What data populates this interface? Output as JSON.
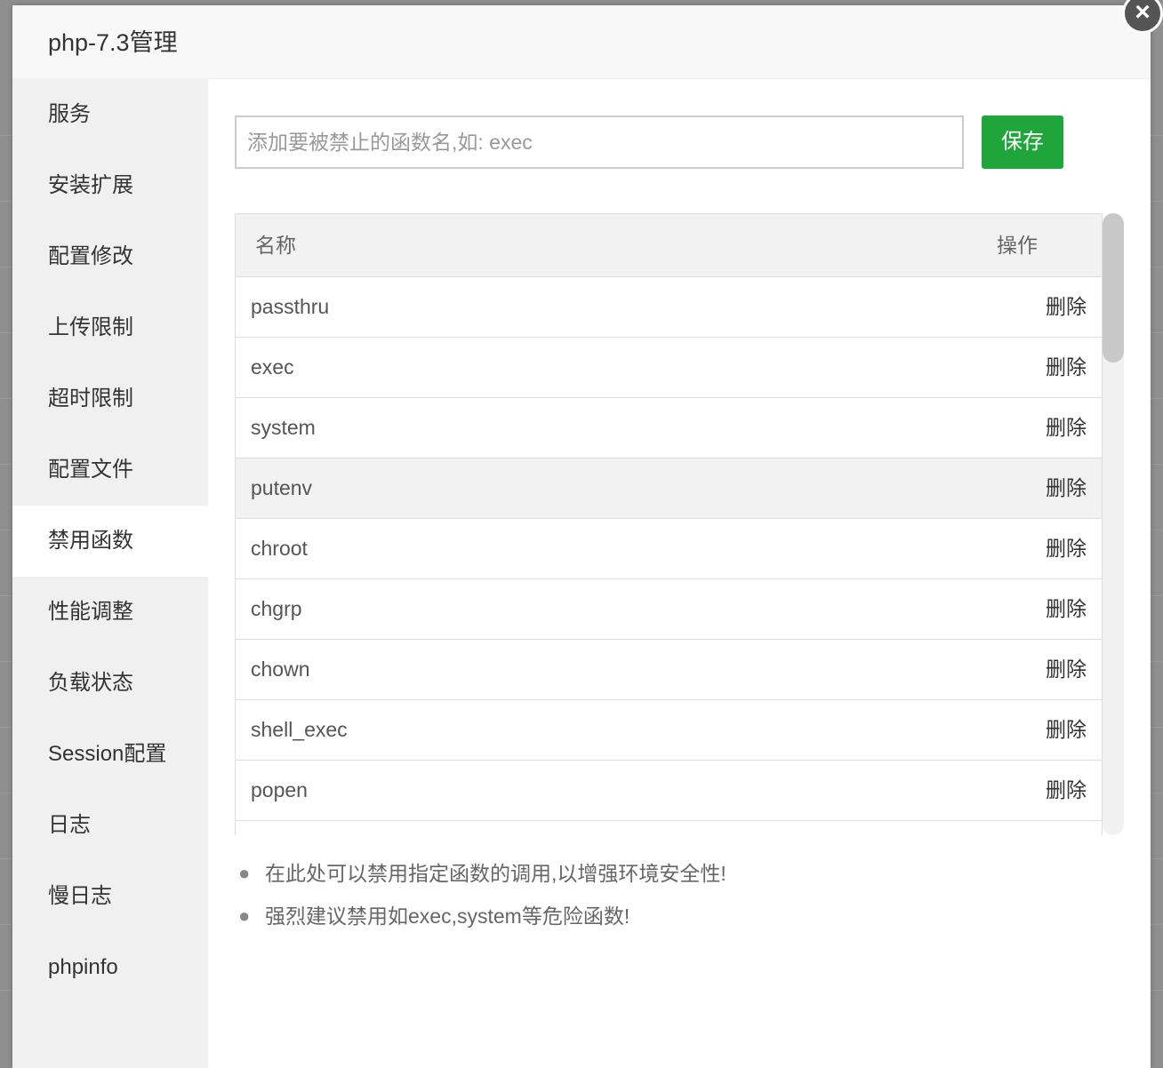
{
  "dialog": {
    "title": "php-7.3管理",
    "close_icon": "×"
  },
  "sidebar": {
    "items": [
      {
        "label": "服务"
      },
      {
        "label": "安装扩展"
      },
      {
        "label": "配置修改"
      },
      {
        "label": "上传限制"
      },
      {
        "label": "超时限制"
      },
      {
        "label": "配置文件"
      },
      {
        "label": "禁用函数",
        "active": true
      },
      {
        "label": "性能调整"
      },
      {
        "label": "负载状态"
      },
      {
        "label": "Session配置"
      },
      {
        "label": "日志"
      },
      {
        "label": "慢日志"
      },
      {
        "label": "phpinfo"
      }
    ]
  },
  "main": {
    "input": {
      "placeholder": "添加要被禁止的函数名,如: exec",
      "value": ""
    },
    "save_label": "保存",
    "table": {
      "header_name": "名称",
      "header_action": "操作",
      "rows": [
        {
          "name": "passthru",
          "action": "删除"
        },
        {
          "name": "exec",
          "action": "删除"
        },
        {
          "name": "system",
          "action": "删除"
        },
        {
          "name": "putenv",
          "action": "删除"
        },
        {
          "name": "chroot",
          "action": "删除"
        },
        {
          "name": "chgrp",
          "action": "删除"
        },
        {
          "name": "chown",
          "action": "删除"
        },
        {
          "name": "shell_exec",
          "action": "删除"
        },
        {
          "name": "popen",
          "action": "删除"
        }
      ]
    },
    "tips": [
      "在此处可以禁用指定函数的调用,以增强环境安全性!",
      "强烈建议禁用如exec,system等危险函数!"
    ]
  },
  "colors": {
    "accent": "#20a53a",
    "sidebar_bg": "#f0f0f0",
    "backdrop": "#8f8f8f"
  }
}
